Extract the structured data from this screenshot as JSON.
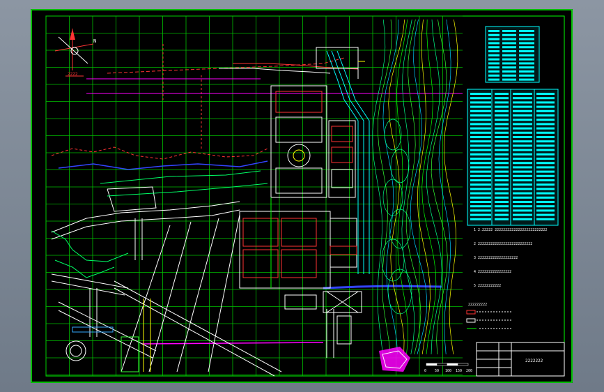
{
  "drawing": {
    "sheet_title": "2222222",
    "scale_ticks": [
      "0",
      "50",
      "100",
      "150",
      "200"
    ],
    "legend_title": "222222222",
    "notes": [
      "1  2.22222 2222222222222222222222222",
      "2  22222222222222222222222222",
      "3  2222222222222222222",
      "4  2222222222222222",
      "5  22222222222"
    ],
    "colors": {
      "background": "#000000",
      "grid": "#00ff00",
      "road": "#ffffff",
      "contour": "#00ff88",
      "property_line": "#ff3333",
      "magenta_line": "#ff00ff",
      "blue_line": "#3344ff",
      "table": "#00ffff"
    }
  }
}
